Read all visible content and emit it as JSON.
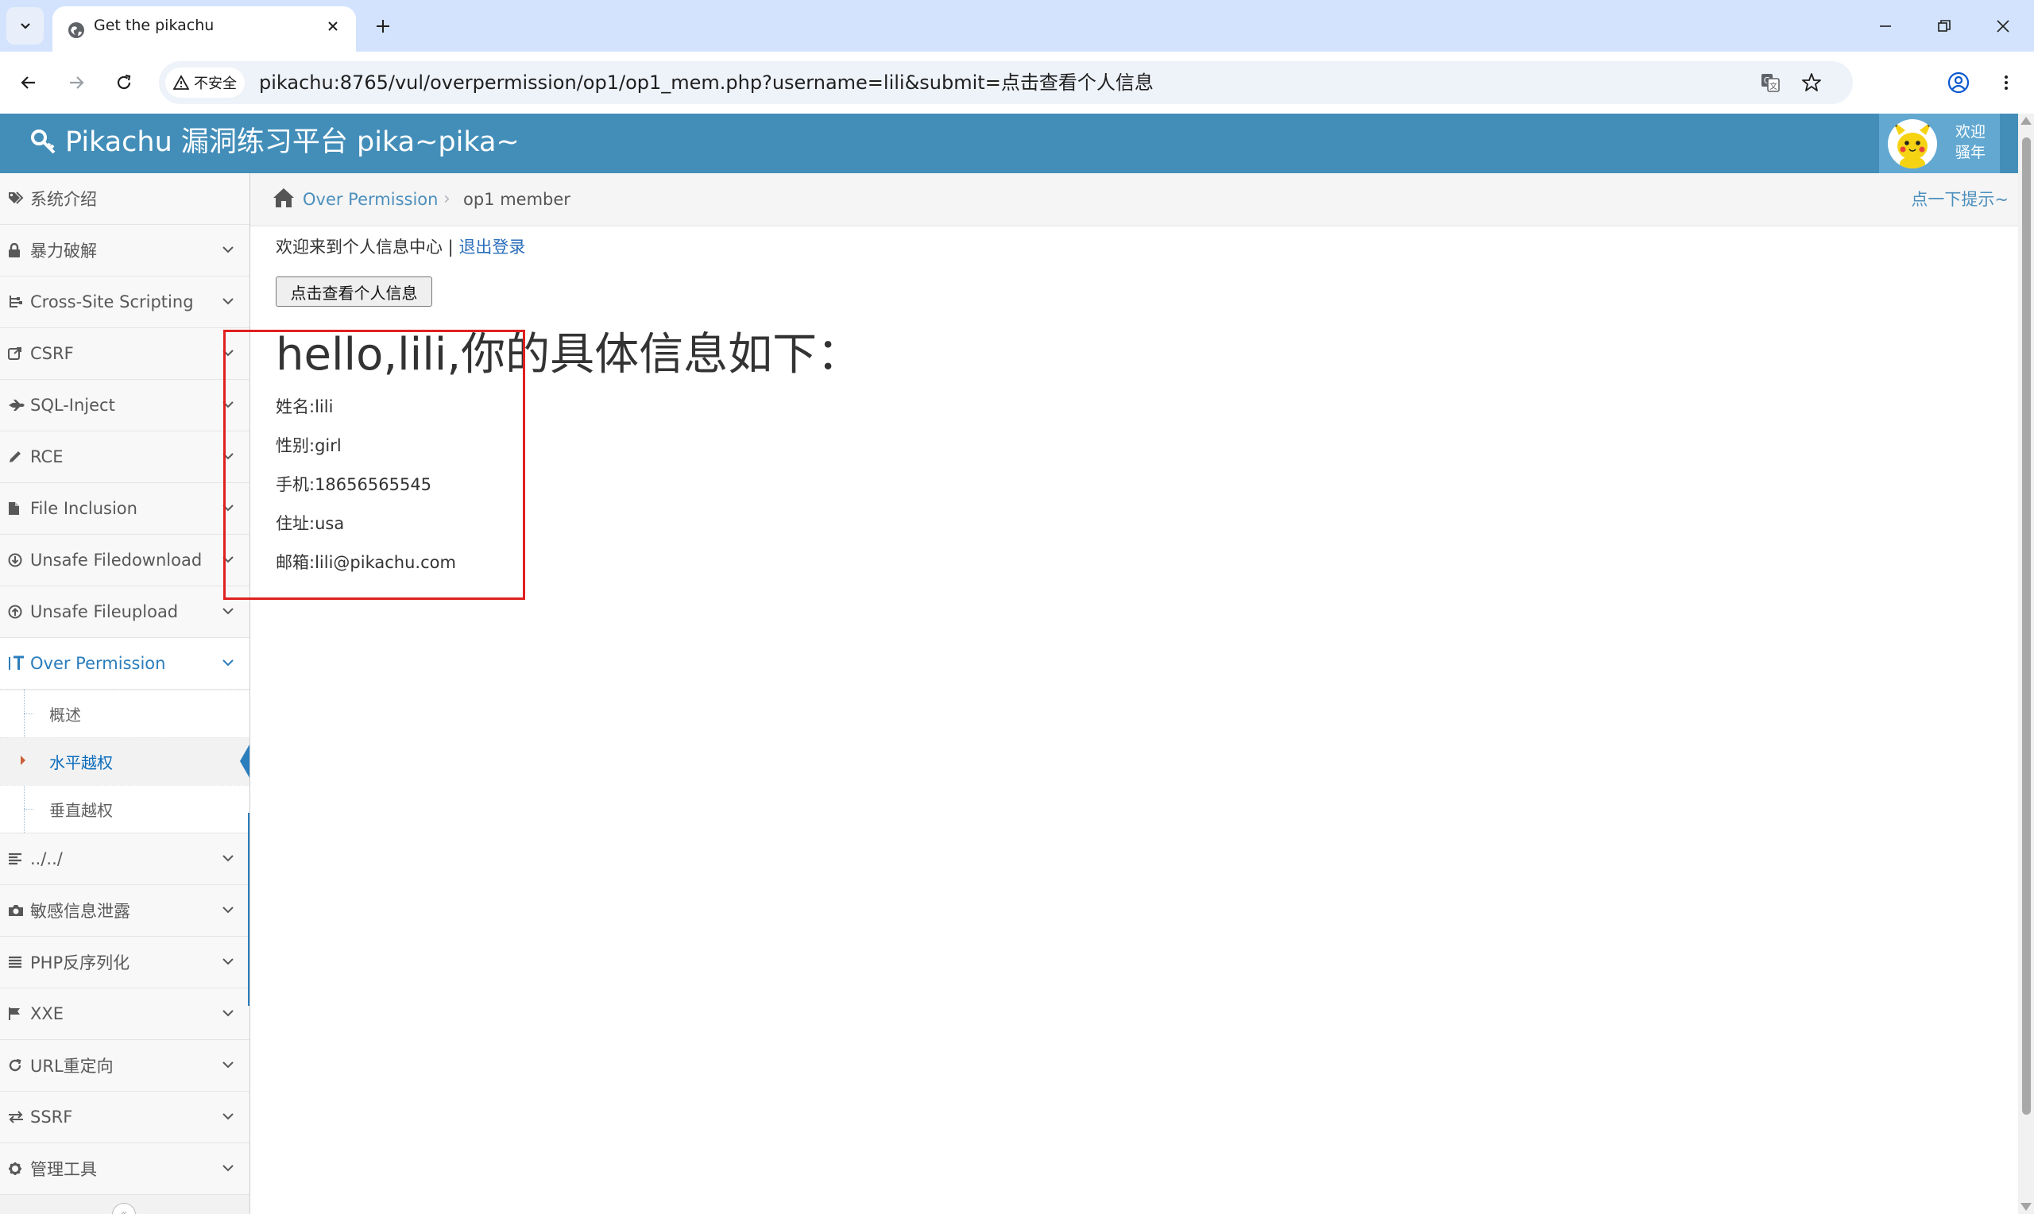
{
  "browser": {
    "tab_title": "Get the pikachu",
    "security_label": "不安全",
    "url": "pikachu:8765/vul/overpermission/op1/op1_mem.php?username=lili&submit=点击查看个人信息"
  },
  "header": {
    "brand": "Pikachu 漏洞练习平台 pika~pika~",
    "welcome_line1": "欢迎",
    "welcome_line2": "骚年"
  },
  "sidebar": {
    "items": [
      {
        "label": "系统介绍",
        "icon": "tags-icon"
      },
      {
        "label": "暴力破解",
        "icon": "lock-icon"
      },
      {
        "label": "Cross-Site Scripting",
        "icon": "sitemap-icon"
      },
      {
        "label": "CSRF",
        "icon": "share-icon"
      },
      {
        "label": "SQL-Inject",
        "icon": "fighter-jet-icon"
      },
      {
        "label": "RCE",
        "icon": "pencil-icon"
      },
      {
        "label": "File Inclusion",
        "icon": "file-icon"
      },
      {
        "label": "Unsafe Filedownload",
        "icon": "download-icon"
      },
      {
        "label": "Unsafe Fileupload",
        "icon": "upload-icon"
      },
      {
        "label": "Over Permission",
        "icon": "text-width-icon"
      },
      {
        "label": "../../",
        "icon": "align-left-icon"
      },
      {
        "label": "敏感信息泄露",
        "icon": "camera-icon"
      },
      {
        "label": "PHP反序列化",
        "icon": "align-justify-icon"
      },
      {
        "label": "XXE",
        "icon": "flag-icon"
      },
      {
        "label": "URL重定向",
        "icon": "repeat-icon"
      },
      {
        "label": "SSRF",
        "icon": "exchange-icon"
      },
      {
        "label": "管理工具",
        "icon": "cog-icon"
      }
    ],
    "submenu": [
      "概述",
      "水平越权",
      "垂直越权"
    ]
  },
  "breadcrumb": {
    "section": "Over Permission",
    "page": "op1 member",
    "hint": "点一下提示~"
  },
  "content": {
    "welcome_text": "欢迎来到个人信息中心",
    "separator": " | ",
    "logout": "退出登录",
    "button_label": "点击查看个人信息",
    "heading": "hello,lili,你的具体信息如下：",
    "name": "姓名:lili",
    "gender": "性别:girl",
    "phone": "手机:18656565545",
    "address": "住址:usa",
    "email": "邮箱:lili@pikachu.com"
  },
  "colors": {
    "header_bg": "#438eb9",
    "accent": "#2b7dbc",
    "highlight": "#e02020"
  }
}
